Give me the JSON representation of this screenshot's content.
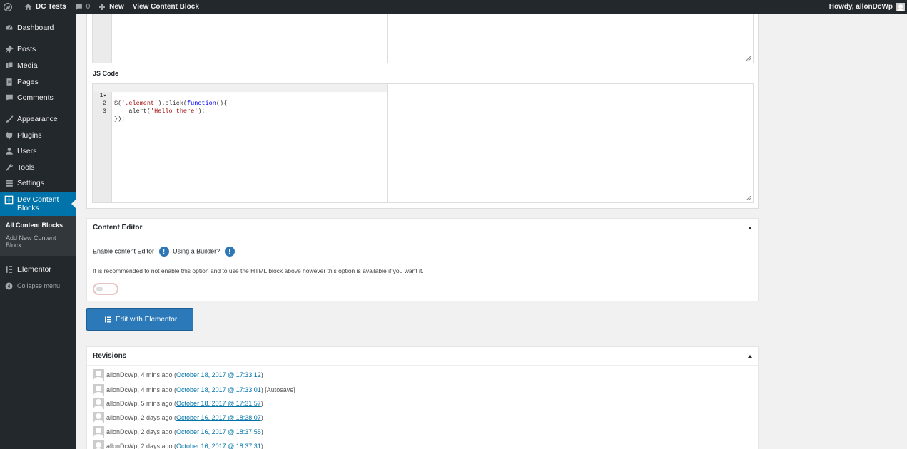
{
  "adminbar": {
    "site_name": "DC Tests",
    "comments_count": "0",
    "new_label": "New",
    "view_label": "View Content Block",
    "howdy": "Howdy, allonDcWp"
  },
  "sidebar": {
    "items": [
      {
        "label": "Dashboard",
        "icon": "dashboard-icon"
      },
      {
        "label": "Posts",
        "icon": "pin-icon"
      },
      {
        "label": "Media",
        "icon": "media-icon"
      },
      {
        "label": "Pages",
        "icon": "pages-icon"
      },
      {
        "label": "Comments",
        "icon": "comment-icon"
      },
      {
        "label": "Appearance",
        "icon": "brush-icon"
      },
      {
        "label": "Plugins",
        "icon": "plugin-icon"
      },
      {
        "label": "Users",
        "icon": "user-icon"
      },
      {
        "label": "Tools",
        "icon": "wrench-icon"
      },
      {
        "label": "Settings",
        "icon": "settings-icon"
      },
      {
        "label": "Dev Content Blocks",
        "icon": "grid-icon"
      },
      {
        "label": "Elementor",
        "icon": "elementor-icon"
      },
      {
        "label": "Collapse menu",
        "icon": "collapse-icon"
      }
    ],
    "submenu": [
      {
        "label": "All Content Blocks"
      },
      {
        "label": "Add New Content Block"
      }
    ]
  },
  "editor": {
    "js_label": "JS Code",
    "js_lines": [
      {
        "n": "1",
        "fold": "▾"
      },
      {
        "n": "2"
      },
      {
        "n": "3"
      }
    ]
  },
  "content_editor": {
    "title": "Content Editor",
    "enable_label": "Enable content Editor",
    "builder_label": "Using a Builder?",
    "info_glyph": "!",
    "note": "It is recommended to not enable this option and to use the HTML block above however this option is available if you want it."
  },
  "elementor_button": {
    "label": "Edit with Elementor"
  },
  "revisions": {
    "title": "Revisions",
    "items": [
      {
        "author": "allonDcWp, 4 mins ago (",
        "date": "October 18, 2017 @ 17:33:12",
        "suffix": ")"
      },
      {
        "author": "allonDcWp, 4 mins ago (",
        "date": "October 18, 2017 @ 17:33:01",
        "suffix": ") [Autosave]"
      },
      {
        "author": "allonDcWp, 5 mins ago (",
        "date": "October 18, 2017 @ 17:31:57",
        "suffix": ")"
      },
      {
        "author": "allonDcWp, 2 days ago (",
        "date": "October 16, 2017 @ 18:38:07",
        "suffix": ")"
      },
      {
        "author": "allonDcWp, 2 days ago (",
        "date": "October 16, 2017 @ 18:37:55",
        "suffix": ")"
      },
      {
        "author": "allonDcWp, 2 days ago (",
        "date": "October 16, 2017 @ 18:37:31",
        "suffix": ")"
      }
    ]
  },
  "colors": {
    "adminbar_bg": "#23282d",
    "sidebar_current": "#0073aa",
    "button_blue": "#2b79b9",
    "link": "#0073aa",
    "info_badge": "#2e77b6"
  }
}
